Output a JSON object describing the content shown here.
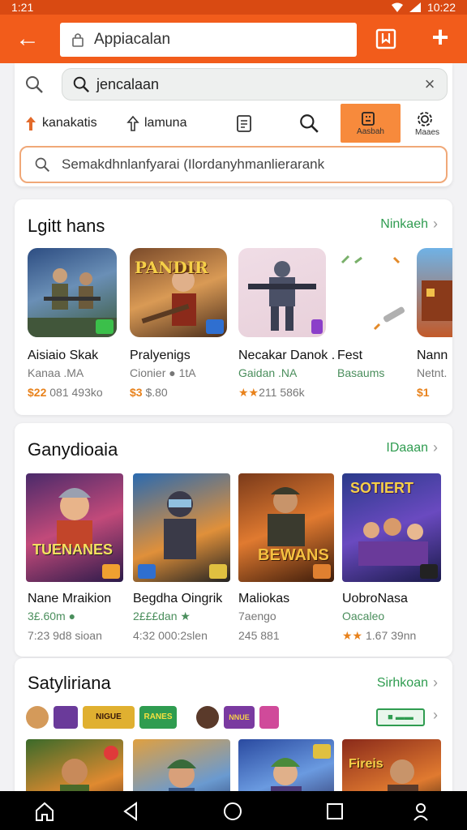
{
  "status": {
    "time_left": "1:21",
    "time_right": "10:22"
  },
  "appbar": {
    "url": "Appiacalan"
  },
  "search": {
    "query": "jencalaan",
    "filter_placeholder": "Semakdhnlanfyarai (Ilordanyhmanlierarank"
  },
  "tools": [
    {
      "label": "kanakatis"
    },
    {
      "label": "lamuna"
    },
    {
      "label": ""
    },
    {
      "label": ""
    },
    {
      "label": "Aasbah"
    },
    {
      "label": "Maaes"
    }
  ],
  "sections": [
    {
      "title": "Lgitt hans",
      "more": "Ninkaeh",
      "apps": [
        {
          "name": "Aisiaio Skak",
          "sub": "Kanaa .MA",
          "price": "$22",
          "price_rest": " 081 493ko"
        },
        {
          "name": "Pralyenigs",
          "sub": "Cionier ● 1tA",
          "price": "$3",
          "price_rest": " $.80"
        },
        {
          "name": "Necakar Danok .",
          "sub": "Gaidan .NA",
          "price": "★★",
          "price_rest": "211 586k"
        },
        {
          "name": "Fest",
          "sub": "Basaums",
          "price": "",
          "price_rest": ""
        },
        {
          "name": "Nann",
          "sub": "Netnt.",
          "price": "$1",
          "price_rest": ""
        }
      ]
    },
    {
      "title": "Ganydioaia",
      "more": "IDaaan",
      "apps": [
        {
          "name": "Nane Mraikion",
          "sub": "3£.60m ●",
          "price": "",
          "price_rest": "7:23 9d8 sioan"
        },
        {
          "name": "Begdha Oingrik",
          "sub": "2£££dan ★",
          "price": "",
          "price_rest": "4:32 000:2slen"
        },
        {
          "name": "Maliokas",
          "sub": "7aengo",
          "price": "",
          "price_rest": "245 881"
        },
        {
          "name": "UobroNasa",
          "sub": "Oacaleo",
          "price": "★★",
          "price_rest": " 1.67 39nn"
        }
      ],
      "art": [
        {
          "line1": "TUENANES"
        },
        {
          "line1": ""
        },
        {
          "line1": "BEWANS"
        },
        {
          "line1": "SOTIERT"
        }
      ]
    },
    {
      "title": "Satyliriana",
      "more": "Sirhkoan",
      "chips": [
        "",
        "NIGUE",
        "RANES",
        "",
        "NNUE",
        "",
        ""
      ],
      "pill": "",
      "art": [
        {
          "line1": ""
        },
        {
          "line1": ""
        },
        {
          "line1": ""
        },
        {
          "line1": "Fireis"
        }
      ]
    }
  ],
  "art_first": {
    "tile2": "PANDIR"
  },
  "colors": {
    "brand": "#f25c1b",
    "status": "#d94a12",
    "link": "#2f9c50",
    "price": "#e8821c"
  }
}
